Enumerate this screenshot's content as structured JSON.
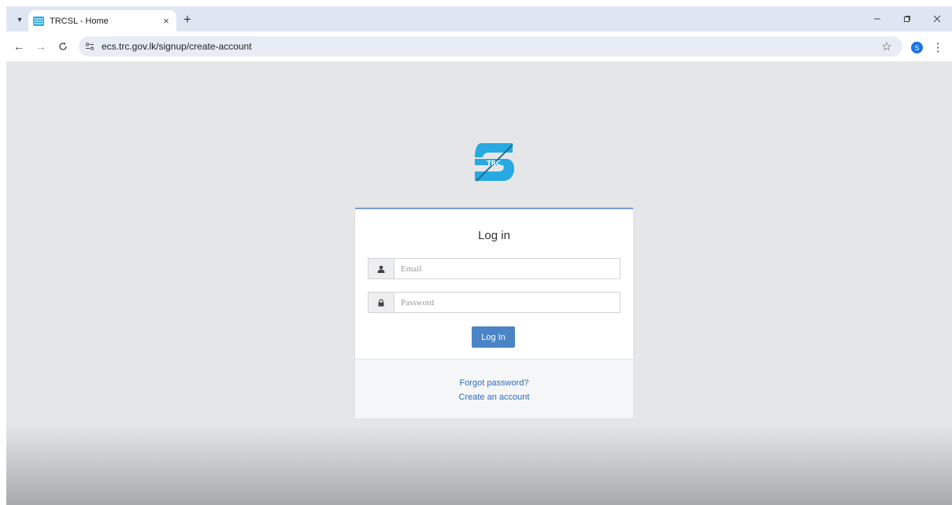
{
  "browser": {
    "tab": {
      "title": "TRCSL - Home",
      "close": "×"
    },
    "new_tab": "+",
    "address": {
      "url": "ecs.trc.gov.lk/signup/create-account"
    },
    "profile_initial": "S",
    "icons": {
      "tab_list": "chevron-down-icon",
      "back": "back-arrow-icon",
      "forward": "forward-arrow-icon",
      "reload": "reload-icon",
      "site_info": "tune-icon",
      "bookmark": "star-icon",
      "menu": "kebab-menu-icon",
      "minimize": "minimize-icon",
      "restore": "restore-icon",
      "close": "close-icon"
    }
  },
  "login": {
    "logo_text": "TRC",
    "title": "Log in",
    "email": {
      "placeholder": "Email",
      "value": ""
    },
    "password": {
      "placeholder": "Password",
      "value": ""
    },
    "submit_label": "Log In",
    "forgot_password": "Forgot password?",
    "create_account": "Create an account"
  },
  "colors": {
    "page_bg": "#e5e6e8",
    "tabstrip_bg": "#dfe6f3",
    "omnibox_bg": "#e8edf5",
    "box_accent": "#7a9cd3",
    "button": "#4a84c7",
    "link": "#2f6cbf",
    "logo": "#27aae1"
  }
}
